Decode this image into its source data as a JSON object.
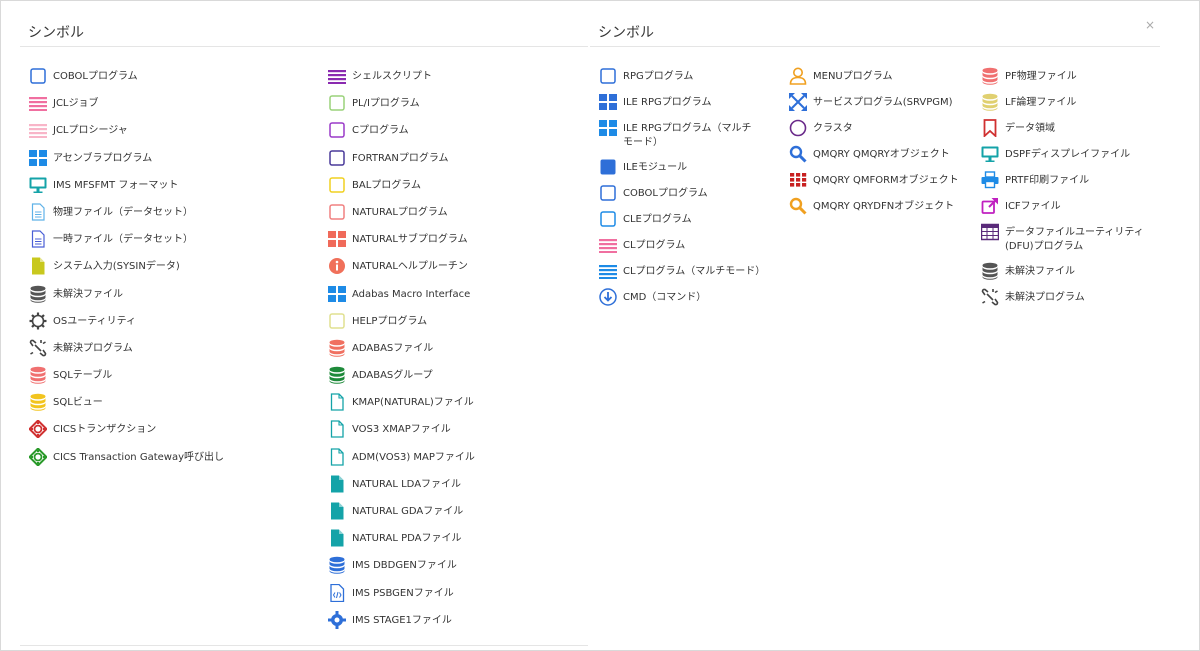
{
  "left": {
    "title": "シンボル",
    "col1": [
      {
        "icon": "square-outline-icon",
        "color": "#2e6fd8",
        "label": "COBOLプログラム"
      },
      {
        "icon": "lines-icon",
        "color": "#f06fa0",
        "label": "JCLジョブ"
      },
      {
        "icon": "lines-icon",
        "color": "#f8b5c8",
        "label": "JCLプロシージャ"
      },
      {
        "icon": "grid-icon",
        "color": "#1e8be6",
        "label": "アセンブラプログラム"
      },
      {
        "icon": "monitor-icon",
        "color": "#14a3a8",
        "label": "IMS MFSFMT フォーマット"
      },
      {
        "icon": "document-icon",
        "color": "#5fb2e8",
        "label": "物理ファイル（データセット）"
      },
      {
        "icon": "document-icon",
        "color": "#4a5fd6",
        "label": "一時ファイル（データセット）"
      },
      {
        "icon": "document-filled-icon",
        "color": "#c8c81e",
        "label": "システム入力(SYSINデータ)"
      },
      {
        "icon": "database-icon",
        "color": "#555555",
        "label": "未解決ファイル"
      },
      {
        "icon": "gear-outline-icon",
        "color": "#444444",
        "label": "OSユーティリティ"
      },
      {
        "icon": "broken-link-icon",
        "color": "#444444",
        "label": "未解決プログラム"
      },
      {
        "icon": "database-icon",
        "color": "#f07070",
        "label": "SQLテーブル"
      },
      {
        "icon": "database-icon",
        "color": "#f2c41e",
        "label": "SQLビュー"
      },
      {
        "icon": "crosshair-icon",
        "color": "#d03030",
        "label": "CICSトランザクション"
      },
      {
        "icon": "crosshair-icon",
        "color": "#2a9a2a",
        "label": "CICS Transaction Gateway呼び出し"
      }
    ],
    "col2": [
      {
        "icon": "lines-icon",
        "color": "#8a2ab0",
        "label": "シェルスクリプト"
      },
      {
        "icon": "square-outline-icon",
        "color": "#9ad27a",
        "label": "PL/Iプログラム"
      },
      {
        "icon": "square-outline-icon",
        "color": "#9a3ac8",
        "label": "Cプログラム"
      },
      {
        "icon": "square-outline-icon",
        "color": "#4a3a9a",
        "label": "FORTRANプログラム"
      },
      {
        "icon": "square-outline-icon",
        "color": "#f0d020",
        "label": "BALプログラム"
      },
      {
        "icon": "square-outline-icon",
        "color": "#f08080",
        "label": "NATURALプログラム"
      },
      {
        "icon": "grid-icon",
        "color": "#f06a5a",
        "label": "NATURALサブプログラム"
      },
      {
        "icon": "info-circle-icon",
        "color": "#f0705a",
        "label": "NATURALヘルプルーチン"
      },
      {
        "icon": "grid-icon",
        "color": "#1e8be6",
        "label": "Adabas Macro Interface"
      },
      {
        "icon": "square-outline-icon",
        "color": "#e0e090",
        "label": "HELPプログラム"
      },
      {
        "icon": "database-icon",
        "color": "#f07060",
        "label": "ADABASファイル"
      },
      {
        "icon": "database-icon",
        "color": "#1e8a3a",
        "label": "ADABASグループ"
      },
      {
        "icon": "document-outline-icon",
        "color": "#14a3a8",
        "label": "KMAP(NATURAL)ファイル"
      },
      {
        "icon": "document-outline-icon",
        "color": "#14a3a8",
        "label": "VOS3 XMAPファイル"
      },
      {
        "icon": "document-outline-icon",
        "color": "#14a3a8",
        "label": "ADM(VOS3) MAPファイル"
      },
      {
        "icon": "document-filled-icon",
        "color": "#14a3a8",
        "label": "NATURAL LDAファイル"
      },
      {
        "icon": "document-filled-icon",
        "color": "#14a3a8",
        "label": "NATURAL GDAファイル"
      },
      {
        "icon": "document-filled-icon",
        "color": "#14a3a8",
        "label": "NATURAL PDAファイル"
      },
      {
        "icon": "database-icon",
        "color": "#2e6fd8",
        "label": "IMS DBDGENファイル"
      },
      {
        "icon": "code-file-icon",
        "color": "#2e6fd8",
        "label": "IMS PSBGENファイル"
      },
      {
        "icon": "gear-filled-icon",
        "color": "#2e6fd8",
        "label": "IMS STAGE1ファイル"
      }
    ]
  },
  "right": {
    "title": "シンボル",
    "close": "×",
    "col1": [
      {
        "icon": "square-outline-icon",
        "color": "#2e6fd8",
        "label": "RPGプログラム"
      },
      {
        "icon": "grid-icon",
        "color": "#2e6fd8",
        "label": "ILE RPGプログラム"
      },
      {
        "icon": "grid-icon",
        "color": "#1e8be6",
        "label": "ILE RPGプログラム（マルチモード）"
      },
      {
        "icon": "square-filled-icon",
        "color": "#2e6fd8",
        "label": "ILEモジュール"
      },
      {
        "icon": "square-outline-icon",
        "color": "#2e6fd8",
        "label": "COBOLプログラム"
      },
      {
        "icon": "square-outline-icon",
        "color": "#1e8be6",
        "label": "CLEプログラム"
      },
      {
        "icon": "lines-icon",
        "color": "#f06fa0",
        "label": "CLプログラム"
      },
      {
        "icon": "lines-icon",
        "color": "#1e8be6",
        "label": "CLプログラム（マルチモード）"
      },
      {
        "icon": "download-circle-icon",
        "color": "#2e6fd8",
        "label": "CMD（コマンド）"
      }
    ],
    "col2": [
      {
        "icon": "user-icon",
        "color": "#f0a020",
        "label": "MENUプログラム"
      },
      {
        "icon": "expand-arrows-icon",
        "color": "#2e6fd8",
        "label": "サービスプログラム(SRVPGM)"
      },
      {
        "icon": "circle-outline-icon",
        "color": "#6a2a8a",
        "label": "クラスタ"
      },
      {
        "icon": "search-icon",
        "color": "#2e6fd8",
        "label": "QMQRY QMQRYオブジェクト"
      },
      {
        "icon": "dots-grid-icon",
        "color": "#c82020",
        "label": "QMQRY QMFORMオブジェクト"
      },
      {
        "icon": "search-icon",
        "color": "#f0a020",
        "label": "QMQRY QRYDFNオブジェクト"
      }
    ],
    "col3": [
      {
        "icon": "database-icon",
        "color": "#f07070",
        "label": "PF物理ファイル"
      },
      {
        "icon": "database-icon",
        "color": "#e0d070",
        "label": "LF論理ファイル"
      },
      {
        "icon": "bookmark-icon",
        "color": "#d03030",
        "label": "データ領域"
      },
      {
        "icon": "monitor-icon",
        "color": "#14a3a8",
        "label": "DSPFディスプレイファイル"
      },
      {
        "icon": "printer-icon",
        "color": "#1e8be6",
        "label": "PRTF印刷ファイル"
      },
      {
        "icon": "external-link-icon",
        "color": "#c020c0",
        "label": "ICFファイル"
      },
      {
        "icon": "table-icon",
        "color": "#5a2a7a",
        "label": "データファイルユーティリティ(DFU)プログラム"
      },
      {
        "icon": "database-icon",
        "color": "#555555",
        "label": "未解決ファイル"
      },
      {
        "icon": "broken-link-icon",
        "color": "#444444",
        "label": "未解決プログラム"
      }
    ]
  }
}
